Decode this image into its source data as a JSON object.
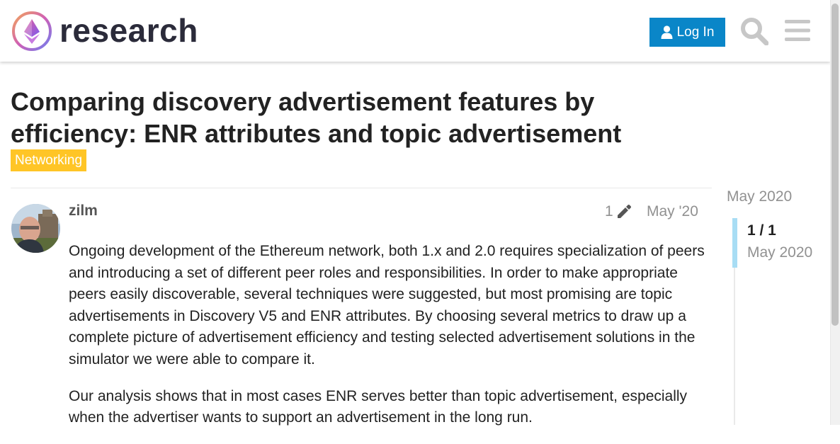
{
  "header": {
    "site_name": "research",
    "login_label": "Log In",
    "brand_color": "#0a86c8"
  },
  "topic": {
    "title": "Comparing discovery advertisement features by efficiency: ENR attributes and topic advertisement",
    "category": "Networking",
    "category_color": "#ffc526"
  },
  "post": {
    "username": "zilm",
    "edit_count": "1",
    "date": "May '20",
    "paragraphs": [
      "Ongoing development of the Ethereum network, both 1.x and 2.0 requires specialization of peers and introducing a set of different peer roles and responsibilities. In order to make appropriate peers easily discoverable, several techniques were suggested, but most promising are topic advertisements in Discovery V5 and ENR attributes. By choosing several metrics to draw up a complete picture of advertisement efficiency and testing selected advertisement solutions in the simulator we were able to compare it.",
      "Our analysis shows that in most cases ENR serves better than topic advertisement, especially when the advertiser wants to support an advertisement in the long run."
    ]
  },
  "timeline": {
    "start_date": "May 2020",
    "position": "1 / 1",
    "current_date": "May 2020"
  },
  "icons": [
    "logo-icon",
    "user-icon",
    "search-icon",
    "hamburger-menu-icon",
    "pencil-icon"
  ]
}
